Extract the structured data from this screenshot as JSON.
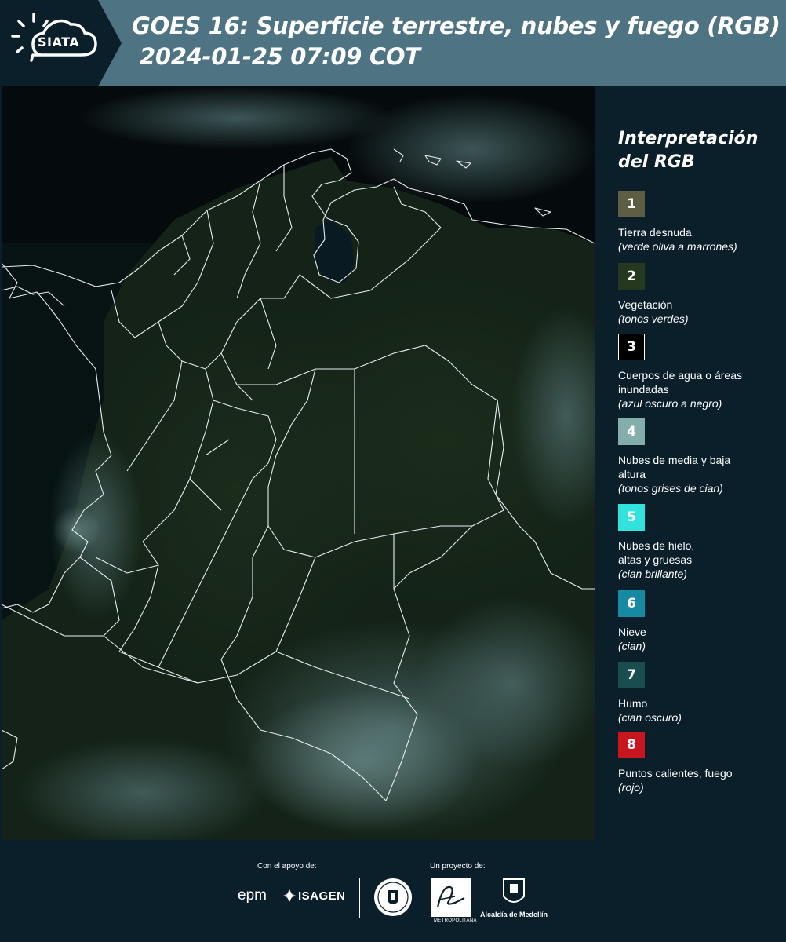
{
  "header": {
    "title_line1": "GOES 16: Superficie terrestre, nubes y fuego (RGB)",
    "title_line2": "2024-01-25 07:09 COT",
    "logo_text": "SIATA"
  },
  "map": {
    "icon": "satellite-map"
  },
  "legend": {
    "title": "Interpretación del RGB",
    "items": [
      {
        "number": "1",
        "label": "Tierra desnuda",
        "sub": "(verde oliva a marrones)",
        "color": "#5e5e44"
      },
      {
        "number": "2",
        "label": "Vegetación",
        "sub": "(tonos verdes)",
        "color": "#26391f"
      },
      {
        "number": "3",
        "label": "Cuerpos de agua o áreas inundadas",
        "sub": "(azul oscuro a negro)",
        "color": "#000000"
      },
      {
        "number": "4",
        "label": "Nubes de media y baja altura",
        "sub": "(tonos grises de cian)",
        "color": "#83aeaa"
      },
      {
        "number": "5",
        "label": "Nubes de hielo, altas y gruesas",
        "sub": "(cian brillante)",
        "color": "#31e3de"
      },
      {
        "number": "6",
        "label": "Nieve",
        "sub": "(cian)",
        "color": "#168aa2"
      },
      {
        "number": "7",
        "label": "Humo",
        "sub": "(cian oscuro)",
        "color": "#1a4d4f"
      },
      {
        "number": "8",
        "label": "Puntos calientes, fuego",
        "sub": "(rojo)",
        "color": "#c8161e"
      }
    ]
  },
  "footer": {
    "support_caption": "Con el apoyo de:",
    "project_caption": "Un proyecto de:",
    "epm": "epm",
    "isagen": "ISAGEN",
    "area_text": "METROPOLITANA",
    "medellin": "Alcaldía de Medellín"
  }
}
